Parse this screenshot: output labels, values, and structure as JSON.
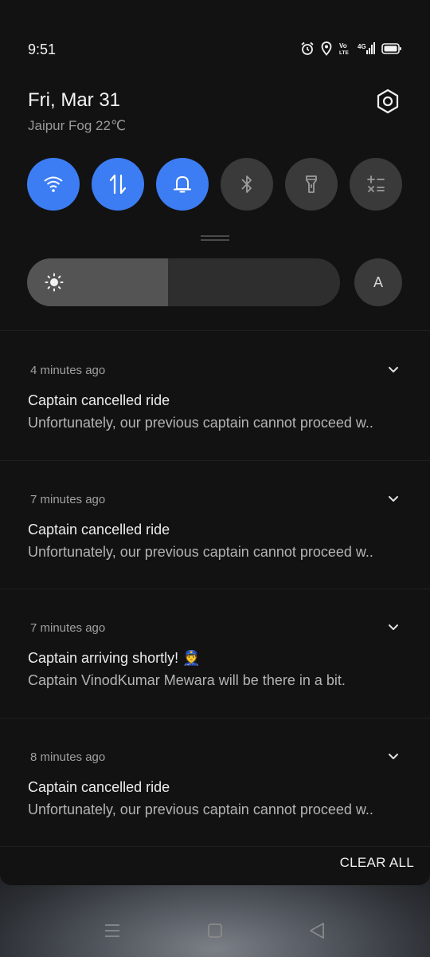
{
  "status_bar": {
    "time": "9:51",
    "icons": [
      "alarm-icon",
      "location-icon",
      "volte-icon",
      "4g-signal-icon",
      "battery-icon"
    ],
    "volte_label": "Vo\nLTE",
    "network_label": "4G"
  },
  "header": {
    "date": "Fri, Mar 31",
    "weather": "Jaipur Fog 22℃",
    "settings_icon": "gear-icon"
  },
  "quick_settings": {
    "accent_color": "#3d7df3",
    "tiles": [
      {
        "name": "wifi",
        "icon": "wifi-icon",
        "state": "on"
      },
      {
        "name": "mobile-data",
        "icon": "data-arrows-icon",
        "state": "on"
      },
      {
        "name": "sound",
        "icon": "bell-icon",
        "state": "on"
      },
      {
        "name": "bluetooth",
        "icon": "bluetooth-icon",
        "state": "off"
      },
      {
        "name": "flashlight",
        "icon": "flashlight-icon",
        "state": "off"
      },
      {
        "name": "calculator",
        "icon": "calculator-icon",
        "state": "off"
      }
    ]
  },
  "brightness": {
    "level": 0.45,
    "auto_label": "A"
  },
  "notifications": [
    {
      "time": "4 minutes ago",
      "title": "Captain cancelled ride",
      "body": "Unfortunately, our previous captain cannot proceed w.."
    },
    {
      "time": "7 minutes ago",
      "title": "Captain cancelled ride",
      "body": "Unfortunately, our previous captain cannot proceed w.."
    },
    {
      "time": "7 minutes ago",
      "title": "Captain arriving shortly! 👮",
      "body": "Captain VinodKumar Mewara will be there in a bit."
    },
    {
      "time": "8 minutes ago",
      "title": "Captain cancelled ride",
      "body": "Unfortunately, our previous captain cannot proceed w.."
    }
  ],
  "actions": {
    "clear_all": "CLEAR ALL"
  },
  "nav_bar": {
    "buttons": [
      "menu-icon",
      "home-icon",
      "back-icon"
    ]
  }
}
